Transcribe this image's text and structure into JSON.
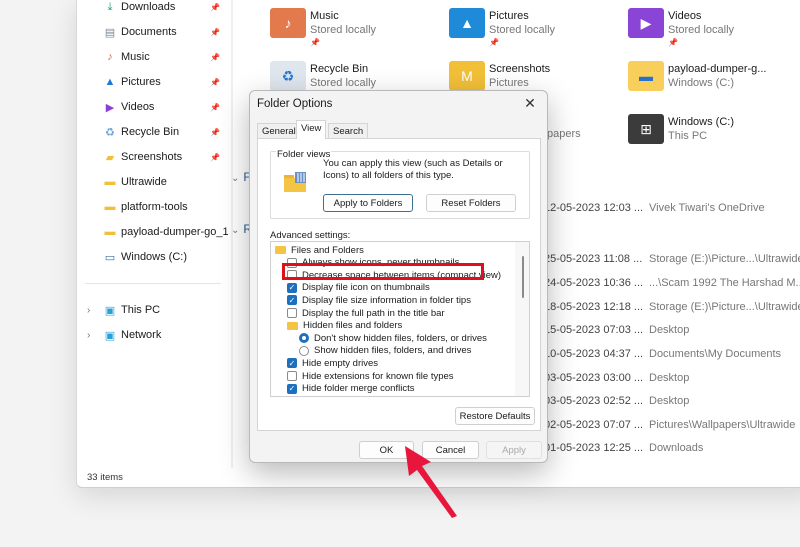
{
  "sidebar": {
    "pinned": [
      {
        "label": "Downloads",
        "icon": "download-icon",
        "color": "#1a9e6e"
      },
      {
        "label": "Documents",
        "icon": "documents-icon",
        "color": "#7a8a9a"
      },
      {
        "label": "Music",
        "icon": "music-icon",
        "color": "#e0654b"
      },
      {
        "label": "Pictures",
        "icon": "pictures-icon",
        "color": "#1e78d6"
      },
      {
        "label": "Videos",
        "icon": "videos-icon",
        "color": "#8b3fd8"
      },
      {
        "label": "Recycle Bin",
        "icon": "recycle-bin-icon",
        "color": "#6aa0d8"
      },
      {
        "label": "Screenshots",
        "icon": "screenshots-folder-icon",
        "color": "#f2c038"
      }
    ],
    "folders": [
      {
        "label": "Ultrawide",
        "icon": "folder-icon"
      },
      {
        "label": "platform-tools",
        "icon": "folder-icon"
      },
      {
        "label": "payload-dumper-go_1",
        "icon": "folder-icon"
      },
      {
        "label": "Windows (C:)",
        "icon": "drive-icon"
      }
    ],
    "roots": [
      {
        "label": "This PC",
        "icon": "this-pc-icon"
      },
      {
        "label": "Network",
        "icon": "network-icon"
      }
    ],
    "pin_glyph": "📌",
    "chevron_glyph": "›"
  },
  "status_bar": {
    "items_count": "33 items"
  },
  "sections": {
    "favorites_initial": "Fa",
    "recent_initial": "R"
  },
  "quick_access": [
    {
      "name": "Music",
      "sub": "Stored locally",
      "pinned": true,
      "icon": "music-folder-icon",
      "color": "#e27a4e"
    },
    {
      "name": "Pictures",
      "sub": "Stored locally",
      "pinned": true,
      "icon": "pictures-folder-icon",
      "color": "#1f8ad8"
    },
    {
      "name": "Videos",
      "sub": "Stored locally",
      "pinned": true,
      "icon": "videos-folder-icon",
      "color": "#8a44d6"
    },
    {
      "name": "Recycle Bin",
      "sub": "Stored locally",
      "pinned": false,
      "icon": "recycle-bin-icon",
      "color": "#dfe6ee"
    },
    {
      "name": "Screenshots",
      "sub": "Pictures",
      "pinned": false,
      "icon": "screenshots-folder-icon",
      "color": "#f2c038"
    },
    {
      "name": "payload-dumper-g...",
      "sub": "Windows (C:)",
      "pinned": false,
      "icon": "folder-icon",
      "color": "#f7cf5a"
    },
    {
      "name": "Windows (C:)",
      "sub": "This PC",
      "pinned": false,
      "icon": "drive-icon",
      "color": "#3b3b3b"
    }
  ],
  "partial_text": {
    "wallpapers_fragment": "papers"
  },
  "recent_rows": [
    {
      "date": "12-05-2023 12:03 ...",
      "location": "Vivek Tiwari's OneDrive"
    },
    {
      "date": "25-05-2023 11:08 ...",
      "location": "Storage (E:)\\Picture...\\Ultrawide"
    },
    {
      "date": "24-05-2023 10:36 ...",
      "location": "...\\Scam 1992 The Harshad M..."
    },
    {
      "date": "18-05-2023 12:18 ...",
      "location": "Storage (E:)\\Picture...\\Ultrawide"
    },
    {
      "date": "15-05-2023 07:03 ...",
      "location": "Desktop"
    },
    {
      "date": "10-05-2023 04:37 ...",
      "location": "Documents\\My Documents"
    },
    {
      "date": "03-05-2023 03:00 ...",
      "location": "Desktop"
    },
    {
      "date": "03-05-2023 02:52 ...",
      "location": "Desktop"
    },
    {
      "date": "02-05-2023 07:07 ...",
      "location": "Pictures\\Wallpapers\\Ultrawide"
    },
    {
      "date": "01-05-2023 12:25 ...",
      "location": "Downloads"
    }
  ],
  "dialog": {
    "title": "Folder Options",
    "close_glyph": "✕",
    "tabs": [
      {
        "label": "General",
        "active": false
      },
      {
        "label": "View",
        "active": true
      },
      {
        "label": "Search",
        "active": false
      }
    ],
    "folder_views": {
      "legend": "Folder views",
      "description": "You can apply this view (such as Details or Icons) to all folders of this type.",
      "apply_label": "Apply to Folders",
      "reset_label": "Reset Folders"
    },
    "advanced_label": "Advanced settings:",
    "tree": [
      {
        "type": "folder",
        "label": "Files and Folders",
        "indent": 0
      },
      {
        "type": "checkbox",
        "label": "Always show icons, never thumbnails",
        "checked": false,
        "indent": 1
      },
      {
        "type": "checkbox",
        "label": "Decrease space between items (compact view)",
        "checked": false,
        "indent": 1,
        "highlighted": true
      },
      {
        "type": "checkbox",
        "label": "Display file icon on thumbnails",
        "checked": true,
        "indent": 1
      },
      {
        "type": "checkbox",
        "label": "Display file size information in folder tips",
        "checked": true,
        "indent": 1
      },
      {
        "type": "checkbox",
        "label": "Display the full path in the title bar",
        "checked": false,
        "indent": 1
      },
      {
        "type": "folder",
        "label": "Hidden files and folders",
        "indent": 1
      },
      {
        "type": "radio",
        "label": "Don't show hidden files, folders, or drives",
        "checked": true,
        "indent": 2
      },
      {
        "type": "radio",
        "label": "Show hidden files, folders, and drives",
        "checked": false,
        "indent": 2
      },
      {
        "type": "checkbox",
        "label": "Hide empty drives",
        "checked": true,
        "indent": 1
      },
      {
        "type": "checkbox",
        "label": "Hide extensions for known file types",
        "checked": false,
        "indent": 1
      },
      {
        "type": "checkbox",
        "label": "Hide folder merge conflicts",
        "checked": true,
        "indent": 1
      }
    ],
    "restore_label": "Restore Defaults",
    "ok_label": "OK",
    "cancel_label": "Cancel",
    "apply_label": "Apply",
    "check_glyph": "✓"
  },
  "annotation": {
    "highlight_color": "#e0101a",
    "arrow_color": "#e8163d"
  }
}
